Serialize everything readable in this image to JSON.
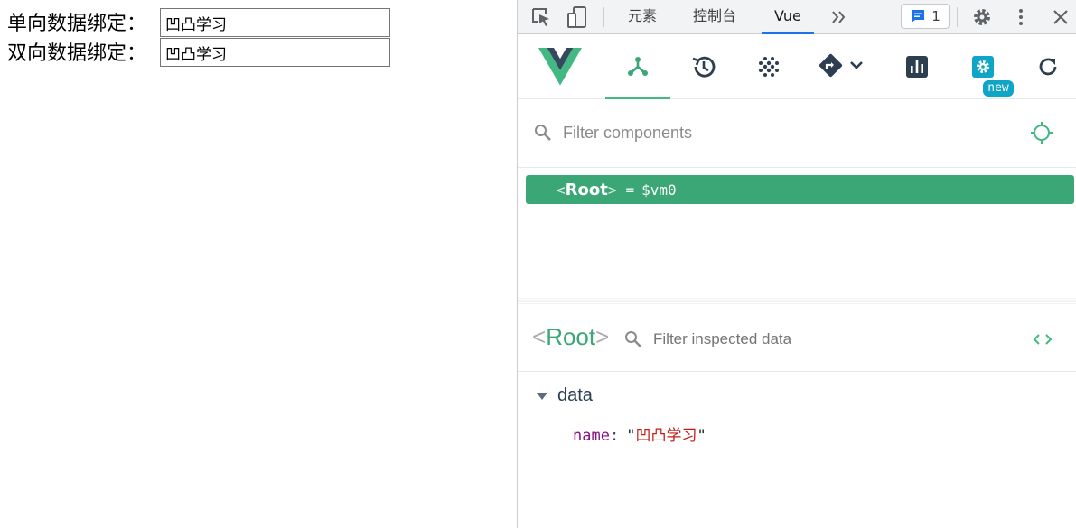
{
  "page": {
    "one_way_label": "单向数据绑定：",
    "one_way_value": "凹凸学习",
    "two_way_label": "双向数据绑定：",
    "two_way_value": "凹凸学习"
  },
  "devtools": {
    "tabs": [
      {
        "label": "元素",
        "active": false
      },
      {
        "label": "控制台",
        "active": false
      },
      {
        "label": "Vue",
        "active": true
      }
    ],
    "more_tabs_icon": "chevron-double-right-icon",
    "issues_count": "1",
    "accent_color": "#1a73e8"
  },
  "vue": {
    "brand_color": "#42b883",
    "nav": [
      {
        "name": "components",
        "icon": "component-tree-icon",
        "active": true
      },
      {
        "name": "timeline",
        "icon": "history-icon",
        "active": false
      },
      {
        "name": "vuex",
        "icon": "dots-grid-icon",
        "active": false
      },
      {
        "name": "routing",
        "icon": "route-sign-icon",
        "active": false
      },
      {
        "name": "performance",
        "icon": "bar-chart-icon",
        "active": false
      },
      {
        "name": "settings",
        "icon": "settings-gear-icon",
        "active": false
      },
      {
        "name": "refresh",
        "icon": "refresh-icon",
        "active": false
      }
    ],
    "settings_badge": "new",
    "filter_components_placeholder": "Filter components",
    "tree": {
      "root_open": "<",
      "root_name": "Root",
      "root_close": ">",
      "root_eq": "=",
      "root_ref": "$vm0",
      "selected_color": "#3ba776"
    },
    "inspector": {
      "open": "<",
      "name": "Root",
      "close": ">",
      "filter_placeholder": "Filter inspected data",
      "section": "data",
      "entries": [
        {
          "key": "name",
          "open_quote": "\"",
          "value": "凹凸学习",
          "close_quote": "\""
        }
      ]
    }
  }
}
